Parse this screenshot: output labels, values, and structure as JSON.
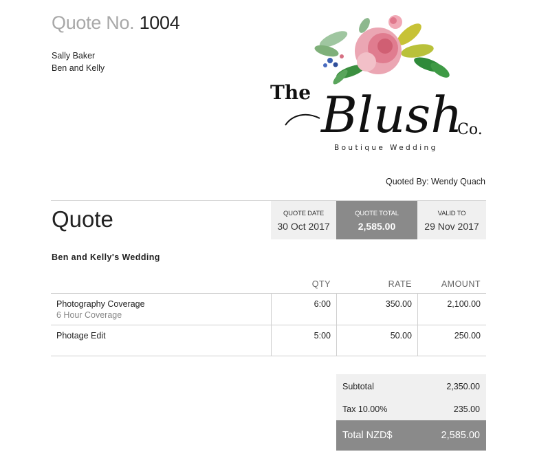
{
  "quote": {
    "label": "Quote No.",
    "number": "1004"
  },
  "client": {
    "name": "Sally Baker",
    "event_names": "Ben and Kelly"
  },
  "logo": {
    "word_the": "The",
    "word_blush": "Blush",
    "word_co": "Co.",
    "tagline": "Boutique Wedding"
  },
  "quoted_by": "Quoted By: Wendy Quach",
  "title": "Quote",
  "meta": {
    "date_label": "QUOTE DATE",
    "date_value": "30 Oct 2017",
    "total_label": "QUOTE TOTAL",
    "total_value": "2,585.00",
    "valid_label": "VALID TO",
    "valid_value": "29 Nov 2017"
  },
  "event_title": "Ben and Kelly's Wedding",
  "columns": {
    "qty": "QTY",
    "rate": "RATE",
    "amount": "AMOUNT"
  },
  "items": [
    {
      "description": "Photography Coverage",
      "detail": "6 Hour Coverage",
      "qty": "6:00",
      "rate": "350.00",
      "amount": "2,100.00"
    },
    {
      "description": "Photage Edit",
      "detail": "",
      "qty": "5:00",
      "rate": "50.00",
      "amount": "250.00"
    }
  ],
  "totals": {
    "subtotal_label": "Subtotal",
    "subtotal_value": "2,350.00",
    "tax_label": "Tax 10.00%",
    "tax_value": "235.00",
    "total_label": "Total NZD$",
    "total_value": "2,585.00"
  },
  "colors": {
    "accent_gray": "#8a8a8a",
    "light_gray": "#f0f0f0",
    "muted_text": "#a8a8a8"
  }
}
